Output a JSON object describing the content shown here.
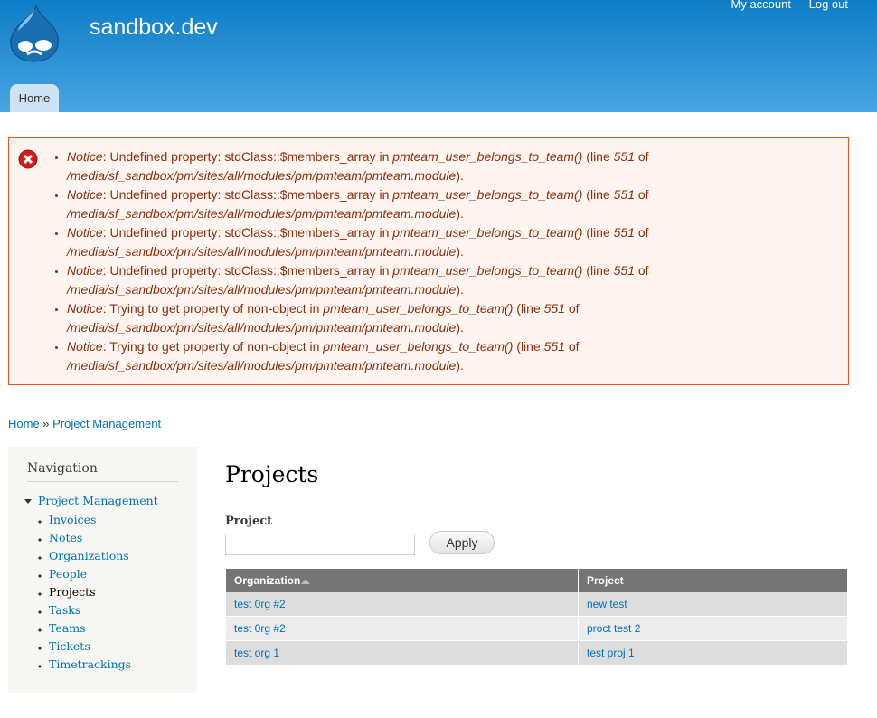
{
  "header": {
    "site_name": "sandbox.dev",
    "my_account": "My account",
    "log_out": "Log out",
    "tabs": [
      {
        "label": "Home"
      }
    ]
  },
  "messages": [
    {
      "notice": "Notice",
      "text": ": Undefined property: stdClass::$members_array in ",
      "function": "pmteam_user_belongs_to_team()",
      "line_pre": " (line ",
      "line": "551",
      "of": " of",
      "path": "/media/sf_sandbox/pm/sites/all/modules/pm/pmteam/pmteam.module",
      "end": ")."
    },
    {
      "notice": "Notice",
      "text": ": Undefined property: stdClass::$members_array in ",
      "function": "pmteam_user_belongs_to_team()",
      "line_pre": " (line ",
      "line": "551",
      "of": " of",
      "path": "/media/sf_sandbox/pm/sites/all/modules/pm/pmteam/pmteam.module",
      "end": ")."
    },
    {
      "notice": "Notice",
      "text": ": Undefined property: stdClass::$members_array in ",
      "function": "pmteam_user_belongs_to_team()",
      "line_pre": " (line ",
      "line": "551",
      "of": " of",
      "path": "/media/sf_sandbox/pm/sites/all/modules/pm/pmteam/pmteam.module",
      "end": ")."
    },
    {
      "notice": "Notice",
      "text": ": Undefined property: stdClass::$members_array in ",
      "function": "pmteam_user_belongs_to_team()",
      "line_pre": " (line ",
      "line": "551",
      "of": " of",
      "path": "/media/sf_sandbox/pm/sites/all/modules/pm/pmteam/pmteam.module",
      "end": ")."
    },
    {
      "notice": "Notice",
      "text": ": Trying to get property of non-object in ",
      "function": "pmteam_user_belongs_to_team()",
      "line_pre": " (line ",
      "line": "551",
      "of": " of",
      "path": "/media/sf_sandbox/pm/sites/all/modules/pm/pmteam/pmteam.module",
      "end": ")."
    },
    {
      "notice": "Notice",
      "text": ": Trying to get property of non-object in ",
      "function": "pmteam_user_belongs_to_team()",
      "line_pre": " (line ",
      "line": "551",
      "of": " of",
      "path": "/media/sf_sandbox/pm/sites/all/modules/pm/pmteam/pmteam.module",
      "end": ")."
    }
  ],
  "breadcrumb": {
    "home": "Home",
    "sep": " » ",
    "current": "Project Management"
  },
  "sidebar": {
    "title": "Navigation",
    "parent": "Project Management",
    "items": [
      "Invoices",
      "Notes",
      "Organizations",
      "People",
      "Projects",
      "Tasks",
      "Teams",
      "Tickets",
      "Timetrackings"
    ],
    "active": "Projects"
  },
  "main": {
    "title": "Projects",
    "filter_label": "Project",
    "filter_value": "",
    "apply": "Apply",
    "table": {
      "headers": [
        "Organization",
        "Project"
      ],
      "rows": [
        [
          "test 0rg #2",
          "new test"
        ],
        [
          "test 0rg #2",
          "proct test 2"
        ],
        [
          "test org 1",
          "test proj 1"
        ]
      ]
    }
  }
}
